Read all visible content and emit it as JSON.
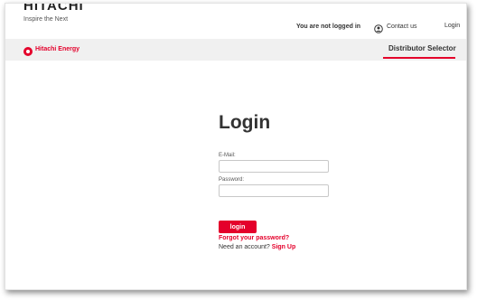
{
  "header": {
    "brand_name": "HITACHI",
    "brand_tagline": "Inspire the Next",
    "login_status": "You are not logged in",
    "contact_label": "Contact us",
    "login_label": "Login"
  },
  "nav": {
    "logo_text": "Hitachi Energy",
    "active_tab": "Distributor Selector"
  },
  "form": {
    "title": "Login",
    "email_label": "E-Mail:",
    "email_value": "",
    "password_label": "Password:",
    "password_value": "",
    "submit_label": "login",
    "forgot_label": "Forgot your password?",
    "signup_prompt": "Need an account?",
    "signup_label": "Sign Up"
  },
  "colors": {
    "accent": "#e4002b",
    "nav_bg": "#f0f0f0",
    "text": "#333333"
  }
}
